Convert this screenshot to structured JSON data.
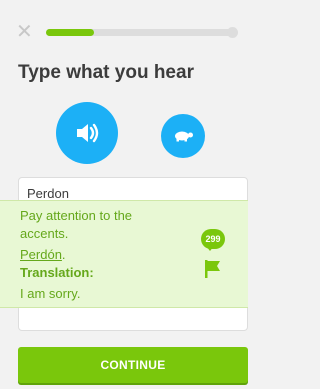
{
  "header": {
    "close_icon": "close-icon",
    "progress_fraction": 0.25
  },
  "lesson": {
    "title": "Type what you hear",
    "speaker_icon": "speaker-icon",
    "slow_icon": "turtle-icon"
  },
  "answer": {
    "typed_value": "Perdon"
  },
  "feedback": {
    "hint": "Pay attention to the",
    "hint_line2": "accents.",
    "correct_word": "Perdón",
    "correct_punct": ".",
    "translation_label": "Translation:",
    "translation_value": "I am sorry.",
    "comment_count": "299",
    "flag_icon": "flag-icon"
  },
  "footer": {
    "continue_label": "CONTINUE"
  },
  "colors": {
    "accent_blue": "#1cb0f6",
    "accent_green": "#7ac70c",
    "feedback_text": "#65a81b"
  }
}
